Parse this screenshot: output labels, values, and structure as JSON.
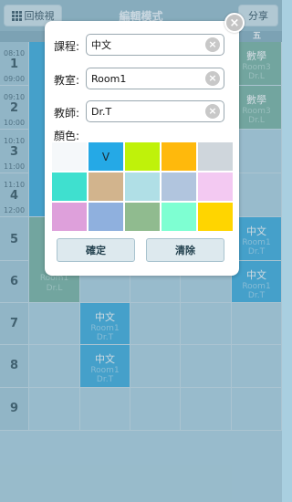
{
  "topbar": {
    "back_label": "回檢視",
    "title": "編輯模式",
    "share_label": "分享"
  },
  "days": {
    "fri": "五"
  },
  "periods": [
    {
      "num": "1",
      "start": "08:10",
      "end": "09:00"
    },
    {
      "num": "2",
      "start": "09:10",
      "end": "10:00"
    },
    {
      "num": "3",
      "start": "10:10",
      "end": "11:00"
    },
    {
      "num": "4",
      "start": "11:10",
      "end": "12:00"
    },
    {
      "num": "5",
      "start": "",
      "end": ""
    },
    {
      "num": "6",
      "start": "",
      "end": ""
    },
    {
      "num": "7",
      "start": "",
      "end": ""
    },
    {
      "num": "8",
      "start": "",
      "end": ""
    },
    {
      "num": "9",
      "start": "",
      "end": ""
    }
  ],
  "courses": {
    "fri_1": {
      "name": "數學",
      "room": "Room3",
      "teacher": "Dr.L"
    },
    "fri_2": {
      "name": "數學",
      "room": "Room3",
      "teacher": "Dr.L"
    },
    "fri_5": {
      "name": "中文",
      "room": "Room1",
      "teacher": "Dr.T"
    },
    "fri_6": {
      "name": "中文",
      "room": "Room1",
      "teacher": "Dr.T"
    },
    "tue_7": {
      "name": "中文",
      "room": "Room1",
      "teacher": "Dr.T"
    },
    "tue_8": {
      "name": "中文",
      "room": "Room1",
      "teacher": "Dr.T"
    },
    "mon_6": {
      "room": "Room1",
      "teacher": "Dr.L"
    }
  },
  "dialog": {
    "course_label": "課程:",
    "course_value": "中文",
    "room_label": "教室:",
    "room_value": "Room1",
    "teacher_label": "教師:",
    "teacher_value": "Dr.T",
    "color_label": "顏色:",
    "selected_mark": "V",
    "confirm_label": "確定",
    "clear_label": "清除",
    "colors": [
      "#f5f8fa",
      "#25a9e6",
      "#bff20a",
      "#ffb90c",
      "#cfd6dc",
      "#3fe0cf",
      "#d2b48d",
      "#b0dfe6",
      "#b1c5de",
      "#f3c9f2",
      "#dea0db",
      "#8fb0de",
      "#90bb8f",
      "#7effd2",
      "#ffd500"
    ]
  }
}
